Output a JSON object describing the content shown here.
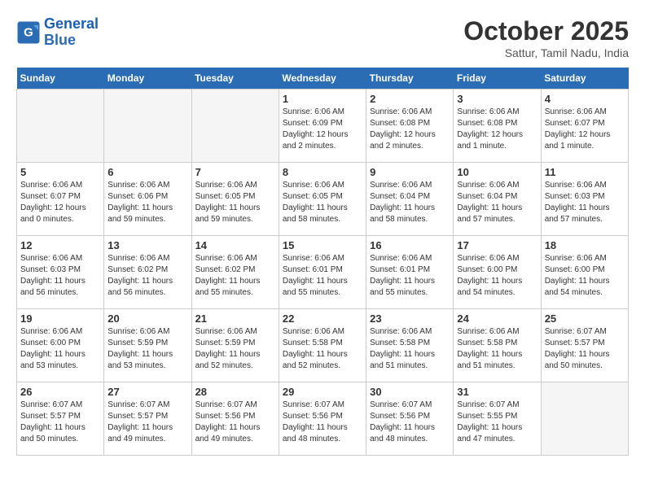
{
  "header": {
    "logo_line1": "General",
    "logo_line2": "Blue",
    "month_title": "October 2025",
    "subtitle": "Sattur, Tamil Nadu, India"
  },
  "weekdays": [
    "Sunday",
    "Monday",
    "Tuesday",
    "Wednesday",
    "Thursday",
    "Friday",
    "Saturday"
  ],
  "weeks": [
    [
      {
        "day": "",
        "info": ""
      },
      {
        "day": "",
        "info": ""
      },
      {
        "day": "",
        "info": ""
      },
      {
        "day": "1",
        "info": "Sunrise: 6:06 AM\nSunset: 6:09 PM\nDaylight: 12 hours\nand 2 minutes."
      },
      {
        "day": "2",
        "info": "Sunrise: 6:06 AM\nSunset: 6:08 PM\nDaylight: 12 hours\nand 2 minutes."
      },
      {
        "day": "3",
        "info": "Sunrise: 6:06 AM\nSunset: 6:08 PM\nDaylight: 12 hours\nand 1 minute."
      },
      {
        "day": "4",
        "info": "Sunrise: 6:06 AM\nSunset: 6:07 PM\nDaylight: 12 hours\nand 1 minute."
      }
    ],
    [
      {
        "day": "5",
        "info": "Sunrise: 6:06 AM\nSunset: 6:07 PM\nDaylight: 12 hours\nand 0 minutes."
      },
      {
        "day": "6",
        "info": "Sunrise: 6:06 AM\nSunset: 6:06 PM\nDaylight: 11 hours\nand 59 minutes."
      },
      {
        "day": "7",
        "info": "Sunrise: 6:06 AM\nSunset: 6:05 PM\nDaylight: 11 hours\nand 59 minutes."
      },
      {
        "day": "8",
        "info": "Sunrise: 6:06 AM\nSunset: 6:05 PM\nDaylight: 11 hours\nand 58 minutes."
      },
      {
        "day": "9",
        "info": "Sunrise: 6:06 AM\nSunset: 6:04 PM\nDaylight: 11 hours\nand 58 minutes."
      },
      {
        "day": "10",
        "info": "Sunrise: 6:06 AM\nSunset: 6:04 PM\nDaylight: 11 hours\nand 57 minutes."
      },
      {
        "day": "11",
        "info": "Sunrise: 6:06 AM\nSunset: 6:03 PM\nDaylight: 11 hours\nand 57 minutes."
      }
    ],
    [
      {
        "day": "12",
        "info": "Sunrise: 6:06 AM\nSunset: 6:03 PM\nDaylight: 11 hours\nand 56 minutes."
      },
      {
        "day": "13",
        "info": "Sunrise: 6:06 AM\nSunset: 6:02 PM\nDaylight: 11 hours\nand 56 minutes."
      },
      {
        "day": "14",
        "info": "Sunrise: 6:06 AM\nSunset: 6:02 PM\nDaylight: 11 hours\nand 55 minutes."
      },
      {
        "day": "15",
        "info": "Sunrise: 6:06 AM\nSunset: 6:01 PM\nDaylight: 11 hours\nand 55 minutes."
      },
      {
        "day": "16",
        "info": "Sunrise: 6:06 AM\nSunset: 6:01 PM\nDaylight: 11 hours\nand 55 minutes."
      },
      {
        "day": "17",
        "info": "Sunrise: 6:06 AM\nSunset: 6:00 PM\nDaylight: 11 hours\nand 54 minutes."
      },
      {
        "day": "18",
        "info": "Sunrise: 6:06 AM\nSunset: 6:00 PM\nDaylight: 11 hours\nand 54 minutes."
      }
    ],
    [
      {
        "day": "19",
        "info": "Sunrise: 6:06 AM\nSunset: 6:00 PM\nDaylight: 11 hours\nand 53 minutes."
      },
      {
        "day": "20",
        "info": "Sunrise: 6:06 AM\nSunset: 5:59 PM\nDaylight: 11 hours\nand 53 minutes."
      },
      {
        "day": "21",
        "info": "Sunrise: 6:06 AM\nSunset: 5:59 PM\nDaylight: 11 hours\nand 52 minutes."
      },
      {
        "day": "22",
        "info": "Sunrise: 6:06 AM\nSunset: 5:58 PM\nDaylight: 11 hours\nand 52 minutes."
      },
      {
        "day": "23",
        "info": "Sunrise: 6:06 AM\nSunset: 5:58 PM\nDaylight: 11 hours\nand 51 minutes."
      },
      {
        "day": "24",
        "info": "Sunrise: 6:06 AM\nSunset: 5:58 PM\nDaylight: 11 hours\nand 51 minutes."
      },
      {
        "day": "25",
        "info": "Sunrise: 6:07 AM\nSunset: 5:57 PM\nDaylight: 11 hours\nand 50 minutes."
      }
    ],
    [
      {
        "day": "26",
        "info": "Sunrise: 6:07 AM\nSunset: 5:57 PM\nDaylight: 11 hours\nand 50 minutes."
      },
      {
        "day": "27",
        "info": "Sunrise: 6:07 AM\nSunset: 5:57 PM\nDaylight: 11 hours\nand 49 minutes."
      },
      {
        "day": "28",
        "info": "Sunrise: 6:07 AM\nSunset: 5:56 PM\nDaylight: 11 hours\nand 49 minutes."
      },
      {
        "day": "29",
        "info": "Sunrise: 6:07 AM\nSunset: 5:56 PM\nDaylight: 11 hours\nand 48 minutes."
      },
      {
        "day": "30",
        "info": "Sunrise: 6:07 AM\nSunset: 5:56 PM\nDaylight: 11 hours\nand 48 minutes."
      },
      {
        "day": "31",
        "info": "Sunrise: 6:07 AM\nSunset: 5:55 PM\nDaylight: 11 hours\nand 47 minutes."
      },
      {
        "day": "",
        "info": ""
      }
    ]
  ]
}
